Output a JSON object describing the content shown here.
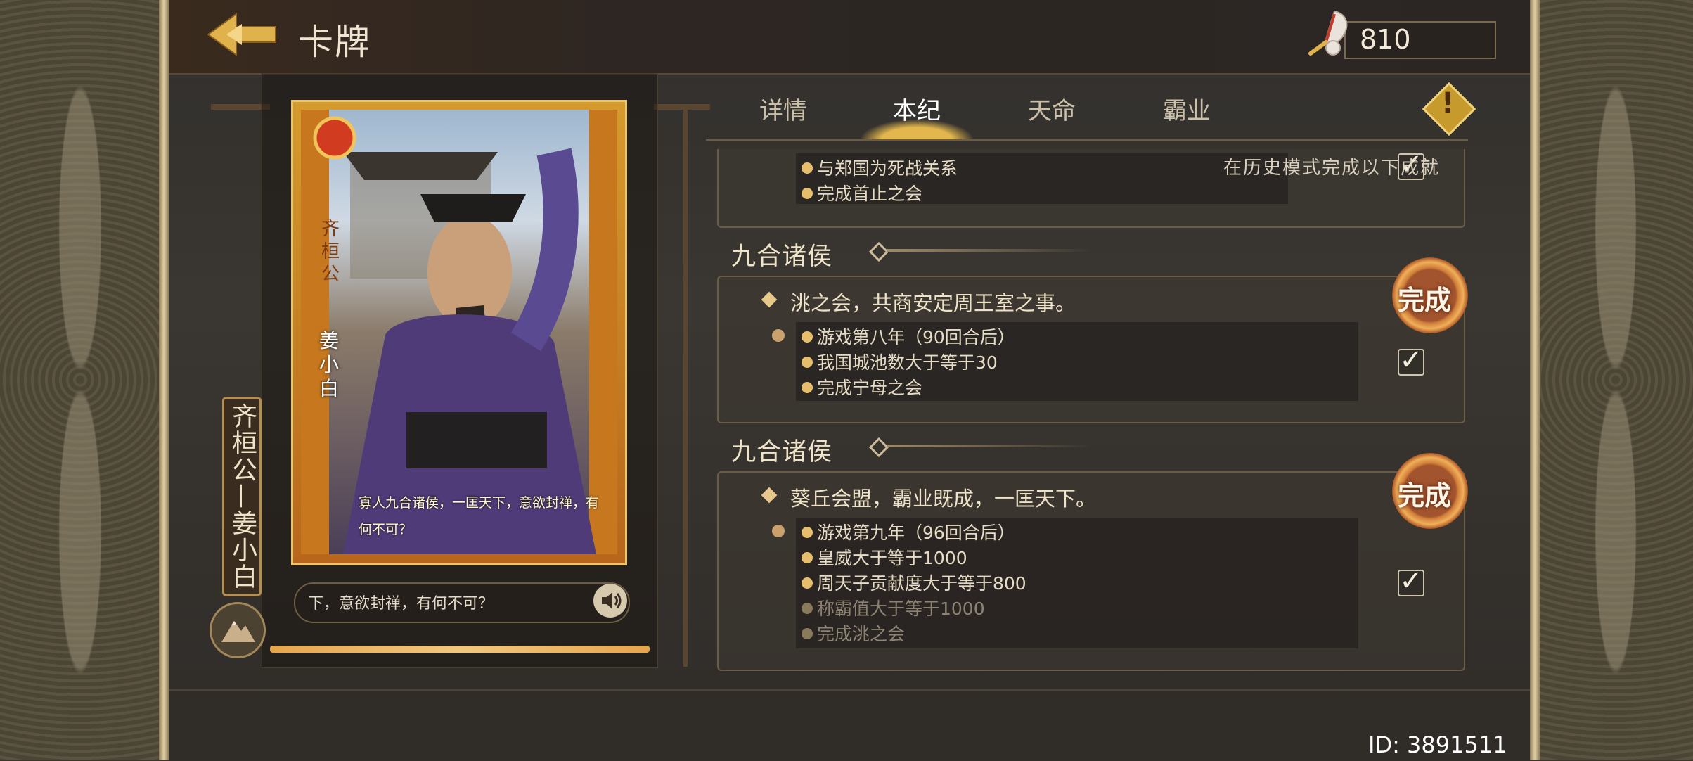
{
  "header": {
    "title": "卡牌",
    "currency_value": "810"
  },
  "card": {
    "hero_name": "齐桓公—姜小白",
    "card_label_gold": "齐桓公",
    "card_label_white": "姜小白",
    "quote": "寡人九合诸侯，一匡天下，意欲封禅，有何不可？",
    "audio_text": "下，意欲封禅，有何不可？"
  },
  "tabs": [
    {
      "label": "详情"
    },
    {
      "label": "本纪"
    },
    {
      "label": "天命"
    },
    {
      "label": "霸业"
    }
  ],
  "history_note": "在历史模式完成以下成就",
  "sections": {
    "top": {
      "conditions": [
        "与郑国为死战关系",
        "完成首止之会"
      ]
    },
    "mid": {
      "title": "九合诸侯",
      "description": "洮之会，共商安定周王室之事。",
      "conditions": [
        "游戏第八年（90回合后）",
        "我国城池数大于等于30",
        "完成宁母之会"
      ],
      "complete_label": "完成"
    },
    "bot": {
      "title": "九合诸侯",
      "description": "葵丘会盟，霸业既成，一匡天下。",
      "conditions": [
        "游戏第九年（96回合后）",
        "皇威大于等于1000",
        "周天子贡献度大于等于800",
        "称霸值大于等于1000",
        "完成洮之会"
      ],
      "complete_label": "完成"
    }
  },
  "footer": {
    "id_text": "ID: 3891511"
  },
  "icons": {
    "back": "arrow-left-icon",
    "currency": "feather-icon",
    "warning": "warning-icon",
    "speaker": "speaker-icon",
    "mountain": "mountain-icon"
  },
  "colors": {
    "accent_gold": "#e7bf6c",
    "seal": "#d17e3a"
  }
}
